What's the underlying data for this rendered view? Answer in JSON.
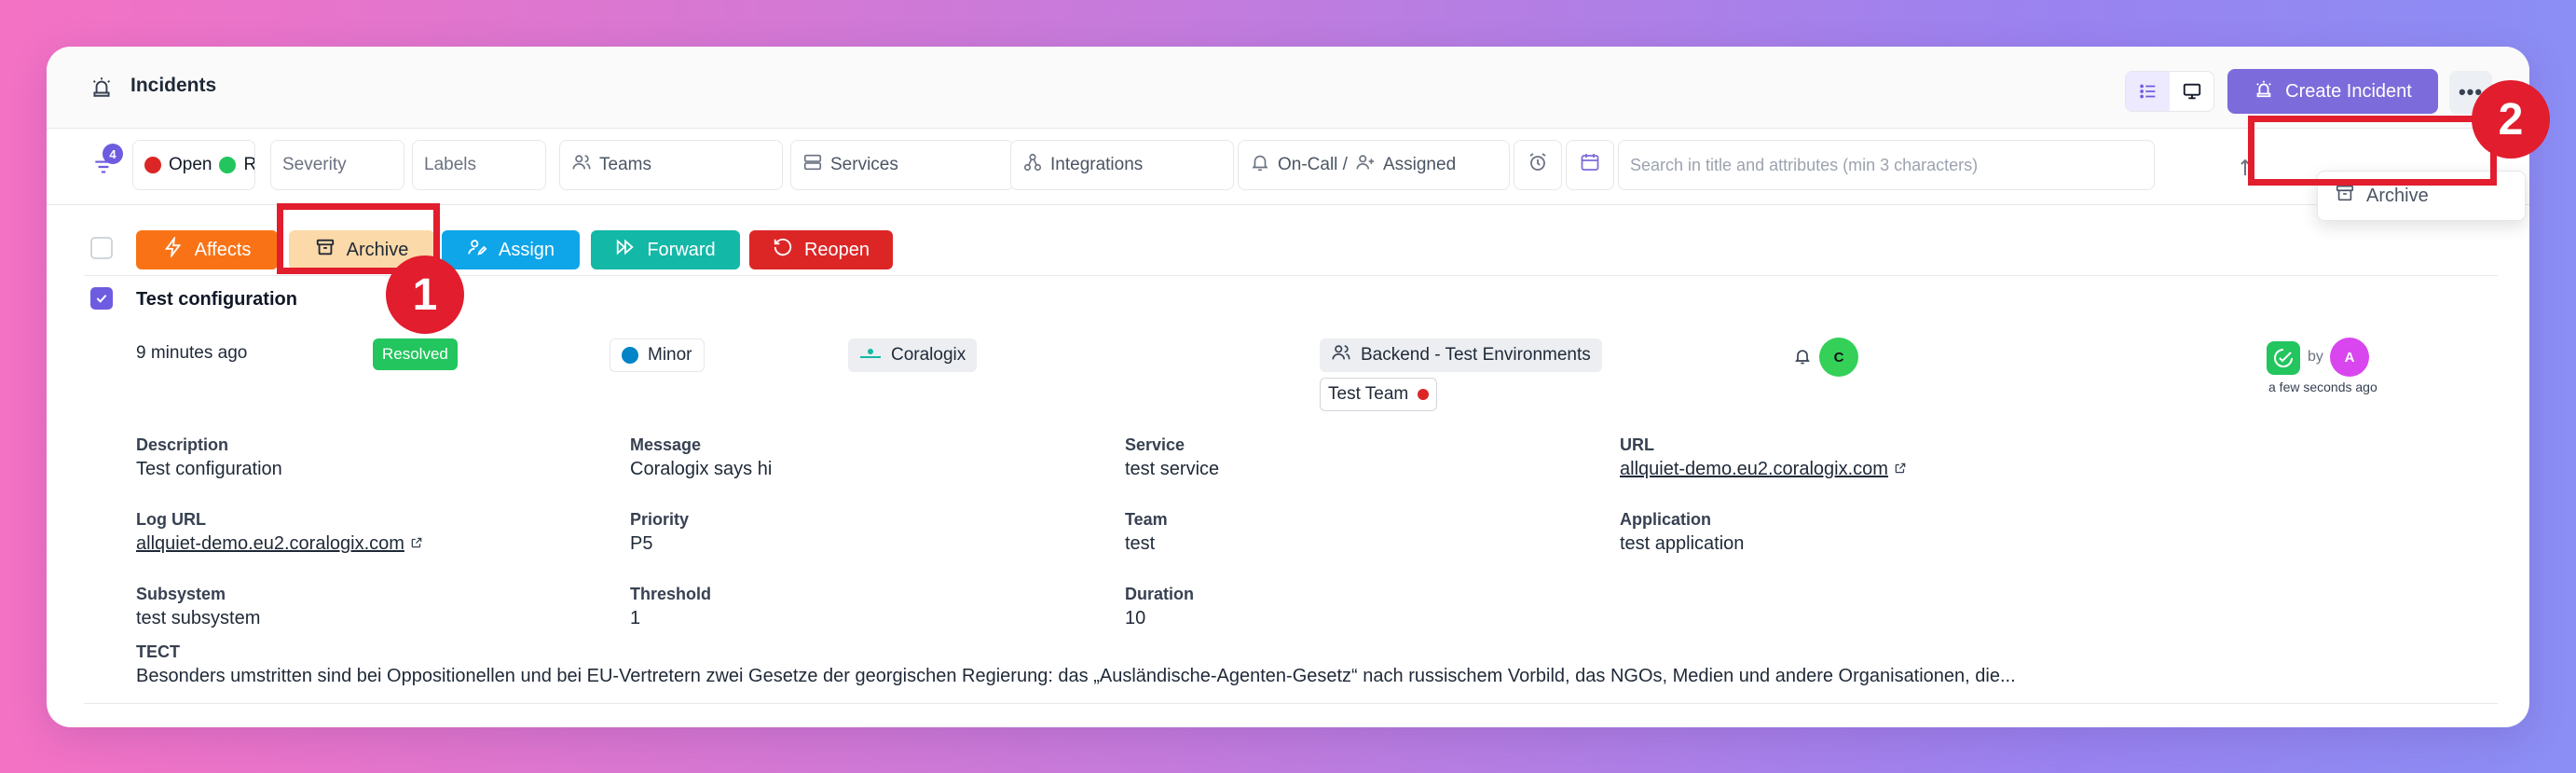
{
  "header": {
    "title": "Incidents",
    "create_label": "Create Incident",
    "more_label": "•••"
  },
  "filters": {
    "badge_count": "4",
    "status_open": "Open",
    "status_resolved_truncated": "Re",
    "severity": "Severity",
    "labels": "Labels",
    "teams": "Teams",
    "services": "Services",
    "integrations": "Integrations",
    "oncall": "On-Call /",
    "assigned": "Assigned",
    "search_placeholder": "Search in title and attributes (min 3 characters)"
  },
  "dropdown": {
    "archive_label": "Archive"
  },
  "actions": {
    "affects": "Affects",
    "archive": "Archive",
    "assign": "Assign",
    "forward": "Forward",
    "reopen": "Reopen"
  },
  "annotations": {
    "step1": "1",
    "step2": "2"
  },
  "incident": {
    "title": "Test configuration",
    "time_ago": "9 minutes ago",
    "status": "Resolved",
    "severity": "Minor",
    "integration": "Coralogix",
    "team_backend": "Backend - Test Environments",
    "team_test": "Test Team",
    "oncall_avatar": "C",
    "resolved_by_label": "by",
    "resolver_avatar": "A",
    "resolved_time": "a few seconds ago",
    "fields": {
      "description_label": "Description",
      "description_value": "Test configuration",
      "message_label": "Message",
      "message_value": "Coralogix says hi",
      "service_label": "Service",
      "service_value": "test service",
      "url_label": "URL",
      "url_value": "allquiet-demo.eu2.coralogix.com",
      "logurl_label": "Log URL",
      "logurl_value": "allquiet-demo.eu2.coralogix.com",
      "priority_label": "Priority",
      "priority_value": "P5",
      "team_label": "Team",
      "team_value": "test",
      "application_label": "Application",
      "application_value": "test application",
      "subsystem_label": "Subsystem",
      "subsystem_value": "test subsystem",
      "threshold_label": "Threshold",
      "threshold_value": "1",
      "duration_label": "Duration",
      "duration_value": "10",
      "tect_label": "TECT",
      "tect_value": "Besonders umstritten sind bei Oppositionellen und bei EU-Vertretern zwei Gesetze der georgischen Regierung: das „Ausländische-Agenten-Gesetz“ nach russischem Vorbild, das NGOs, Medien und andere Organisationen, die..."
    }
  },
  "colors": {
    "primary": "#7c6bdb",
    "affects": "#f97316",
    "archive": "#fcd9a8",
    "assign": "#0ea5e9",
    "forward": "#14b8a6",
    "reopen": "#dc2626",
    "resolved": "#22c55e",
    "annotation_red": "#e11d2e"
  }
}
